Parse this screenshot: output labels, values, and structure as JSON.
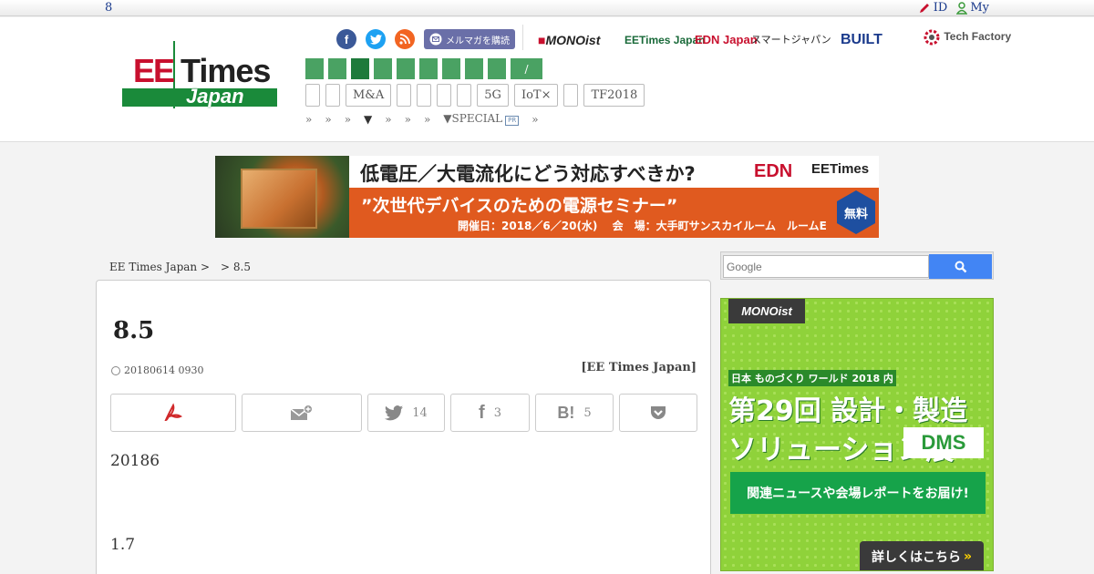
{
  "topbar": {
    "left_text": "8",
    "id_label": "ID",
    "my_label": "My"
  },
  "header": {
    "logo": {
      "ee": "EE",
      "times": "Times",
      "japan": "Japan"
    },
    "mail_button": "メルマガを購読",
    "brands": [
      "MONOist",
      "EETimes Japan",
      "EDN Japan",
      "スマートジャパン",
      "BUILT",
      "Tech Factory"
    ],
    "green_nav_last": "/",
    "tags": [
      "",
      "",
      "M&A",
      "",
      "",
      "",
      "",
      "5G",
      "IoT×",
      "",
      "TF2018"
    ],
    "nav_links": [
      "»",
      "»",
      "»",
      "▼",
      "»",
      "»",
      "»",
      "▼SPECIAL",
      "»"
    ],
    "pr_label": "PR"
  },
  "banner": {
    "headline": "低電圧／大電流化にどう対応すべきか?",
    "subline": "”次世代デバイスのための電源セミナー”",
    "details": "開催日：2018／6／20(水)　 会　場：大手町サンスカイルーム　ルームE",
    "brand_edn": "EDN",
    "brand_eet": "EETimes",
    "free": "無料"
  },
  "breadcrumb": "EE Times Japan >　> 8.5",
  "article": {
    "title": "8.5",
    "date": "20180614 0930",
    "source": "[EE Times Japan]",
    "share": {
      "twitter_count": "14",
      "facebook_count": "3",
      "hatena_count": "5"
    },
    "para1": "20186",
    "para2": "1.7"
  },
  "search": {
    "placeholder": "Google"
  },
  "ad": {
    "brand": "MONOist",
    "line1": "日本 ものづくり ワールド 2018 内",
    "line2": "第29回 設計・製造",
    "line3": "ソリューション展",
    "dms": "DMS",
    "news": "関連ニュースや会場レポートをお届け!",
    "more": "詳しくはこちら",
    "more_arrow": "»"
  },
  "colors": {
    "accent_green": "#4aa263",
    "link_blue": "#1a3a8c",
    "banner_orange": "#e05a1f",
    "ad_green": "#8fd23a"
  }
}
